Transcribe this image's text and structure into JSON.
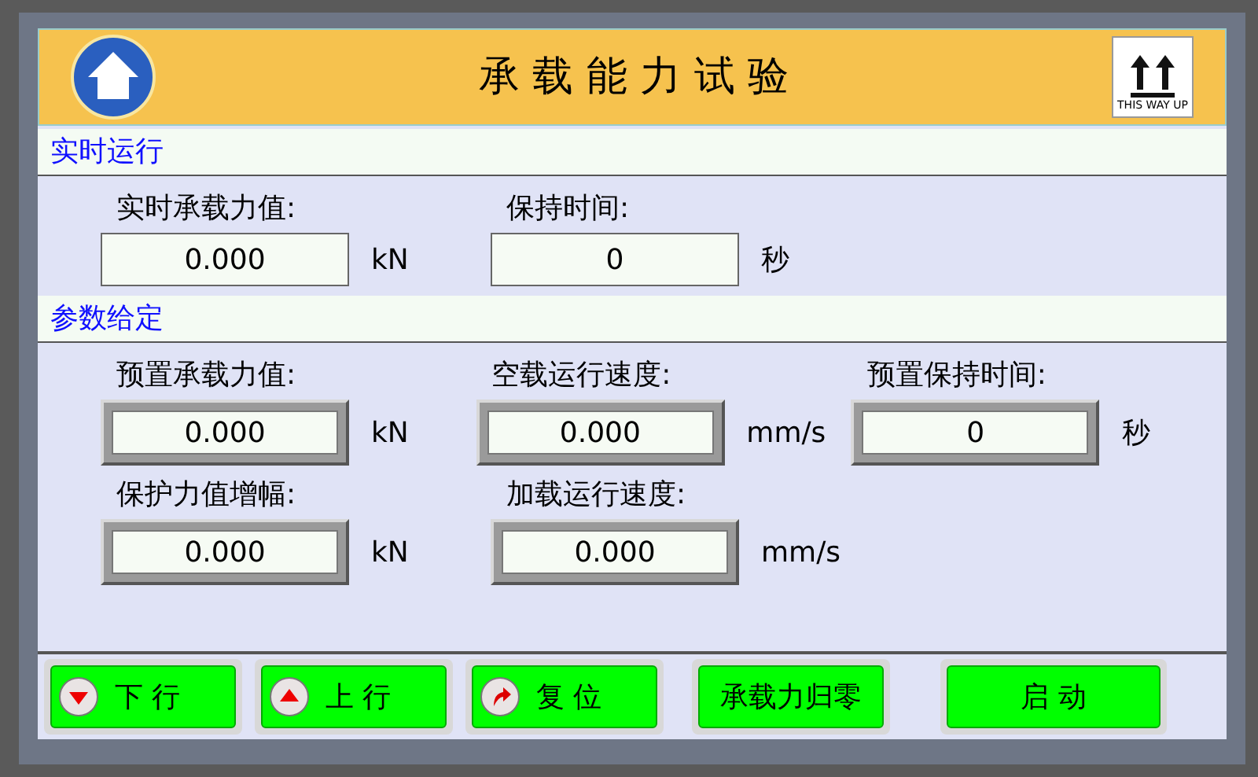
{
  "header": {
    "title": "承 载 能 力 试 验",
    "badge": "THIS WAY UP"
  },
  "sections": [
    {
      "title": "实时运行",
      "rows": [
        [
          {
            "label": "实时承载力值:",
            "value": "0.000",
            "unit": "kN",
            "kind": "display"
          },
          {
            "label": "保持时间:",
            "value": "0",
            "unit": "秒",
            "kind": "display"
          }
        ]
      ]
    },
    {
      "title": "参数给定",
      "rows": [
        [
          {
            "label": "预置承载力值:",
            "value": "0.000",
            "unit": "kN",
            "kind": "input"
          },
          {
            "label": "空载运行速度:",
            "value": "0.000",
            "unit": "mm/s",
            "kind": "input"
          },
          {
            "label": "预置保持时间:",
            "value": "0",
            "unit": "秒",
            "kind": "input"
          }
        ],
        [
          {
            "label": "保护力值增幅:",
            "value": "0.000",
            "unit": "kN",
            "kind": "input"
          },
          {
            "label": "加载运行速度:",
            "value": "0.000",
            "unit": "mm/s",
            "kind": "input"
          }
        ]
      ]
    }
  ],
  "buttons": [
    {
      "label": "下 行",
      "kind": "down"
    },
    {
      "label": "上 行",
      "kind": "up"
    },
    {
      "label": "复 位",
      "kind": "reset"
    },
    {
      "label": "承载力归零",
      "kind": "plain"
    },
    {
      "label": "启 动",
      "kind": "plain"
    }
  ]
}
